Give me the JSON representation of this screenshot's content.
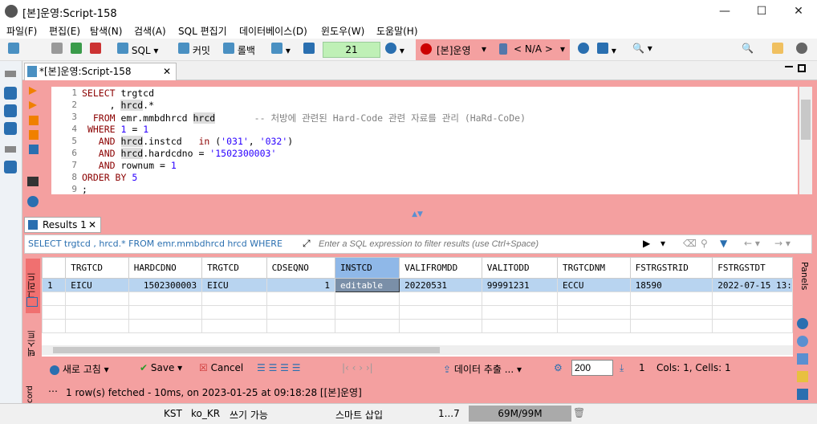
{
  "window": {
    "title": "[본]운영:Script-158"
  },
  "menu": [
    "파일(F)",
    "편집(E)",
    "탐색(N)",
    "검색(A)",
    "SQL 편집기",
    "데이터베이스(D)",
    "윈도우(W)",
    "도움말(H)"
  ],
  "toolbar": {
    "sql_label": "SQL",
    "commit_label": "커밋",
    "rollback_label": "롤백",
    "tx_count": "21",
    "connection": "[본]운영",
    "schema": "< N/A >"
  },
  "editor": {
    "tab_label": "*[본]운영:Script-158",
    "lines": [
      "1",
      "2",
      "3",
      "4",
      "5",
      "6",
      "7",
      "8",
      "9"
    ]
  },
  "results": {
    "tab_label": "Results 1",
    "filter_sql": "SELECT trgtcd , hrcd.* FROM emr.mmbdhrcd hrcd WHERE",
    "filter_placeholder": "Enter a SQL expression to filter results (use Ctrl+Space)",
    "columns": [
      "TRGTCD",
      "HARDCDNO",
      "TRGTCD",
      "CDSEQNO",
      "INSTCD",
      "VALIFROMDD",
      "VALITODD",
      "TRGTCDNM",
      "FSTRGSTRID",
      "FSTRGSTDT"
    ],
    "rows": [
      [
        "1",
        "EICU",
        "1502300003",
        "EICU",
        "1",
        "editable",
        "20220531",
        "99991231",
        "ECCU",
        "18590",
        "2022-07-15 13:"
      ]
    ],
    "side_tabs": {
      "grid": "그리드",
      "text": "텍스트",
      "record": "cord"
    },
    "panels_label": "Panels",
    "bottom": {
      "refresh": "새로 고침",
      "save": "Save",
      "cancel": "Cancel",
      "export": "데이터 추출 ...",
      "fetch_size": "200",
      "fetch_count": "1",
      "cols_cells": "Cols: 1, Cells: 1"
    },
    "status": "1 row(s) fetched - 10ms, on 2023-01-25 at 09:18:28 [[본]운영]"
  },
  "statusbar": {
    "tz": "KST",
    "locale": "ko_KR",
    "mode": "쓰기 가능",
    "insert": "스마트 삽입",
    "pos": "1...7",
    "memory": "69M/99M"
  }
}
